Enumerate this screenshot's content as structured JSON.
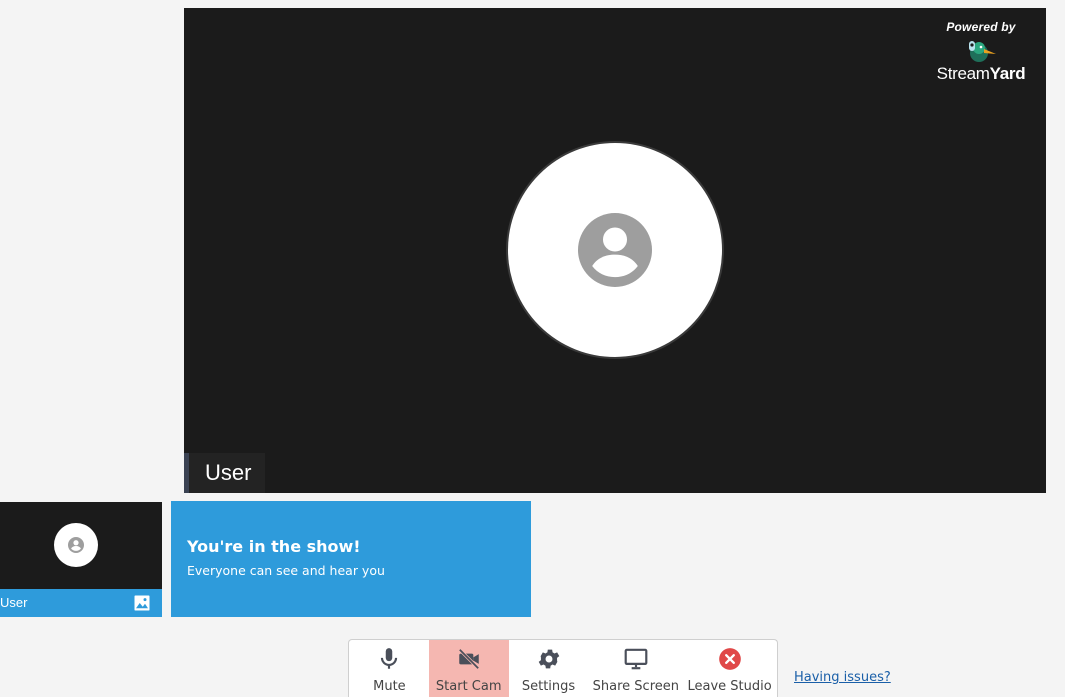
{
  "stage": {
    "powered_by": "Powered by",
    "brand_part1": "Stream",
    "brand_part2": "Yard",
    "participant_name": "User",
    "avatar_icon": "account-circle-icon"
  },
  "thumbnail": {
    "name": "User",
    "avatar_icon": "account-circle-icon",
    "image_icon": "image-icon"
  },
  "banner": {
    "title": "You're in the show!",
    "subtitle": "Everyone can see and hear you"
  },
  "toolbar": {
    "mute_label": "Mute",
    "start_cam_label": "Start Cam",
    "settings_label": "Settings",
    "share_screen_label": "Share Screen",
    "leave_studio_label": "Leave Studio"
  },
  "help": {
    "issues_link": "Having issues?"
  },
  "colors": {
    "stage_bg": "#1b1b1b",
    "accent_blue": "#2e9bdb",
    "cam_off_bg": "#f5b7b1",
    "leave_red": "#e04848",
    "link_blue": "#1a5fa8"
  }
}
